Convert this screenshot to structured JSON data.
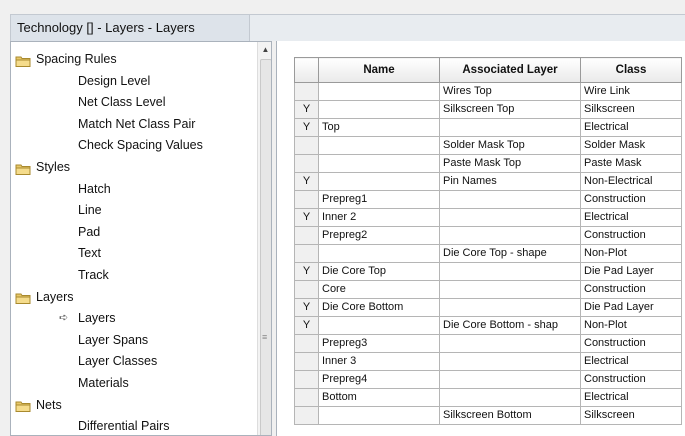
{
  "window": {
    "title": "Technology []  - Layers - Layers"
  },
  "tree": {
    "items": [
      {
        "label": "Spacing Rules",
        "type": "folder"
      },
      {
        "label": "Design Level",
        "type": "leaf"
      },
      {
        "label": "Net Class Level",
        "type": "leaf"
      },
      {
        "label": "Match Net Class Pair",
        "type": "leaf"
      },
      {
        "label": "Check Spacing Values",
        "type": "leaf"
      },
      {
        "label": "Styles",
        "type": "folder"
      },
      {
        "label": "Hatch",
        "type": "leaf"
      },
      {
        "label": "Line",
        "type": "leaf"
      },
      {
        "label": "Pad",
        "type": "leaf"
      },
      {
        "label": "Text",
        "type": "leaf"
      },
      {
        "label": "Track",
        "type": "leaf"
      },
      {
        "label": "Layers",
        "type": "folder"
      },
      {
        "label": "Layers",
        "type": "leaf",
        "selected": true
      },
      {
        "label": "Layer Spans",
        "type": "leaf"
      },
      {
        "label": "Layer Classes",
        "type": "leaf"
      },
      {
        "label": "Materials",
        "type": "leaf"
      },
      {
        "label": "Nets",
        "type": "folder"
      },
      {
        "label": "Differential Pairs",
        "type": "leaf"
      }
    ]
  },
  "grid": {
    "columns": [
      "",
      "Name",
      "Associated Layer",
      "Class"
    ],
    "rows": [
      {
        "flag": "",
        "name": "",
        "assoc": "Wires Top",
        "cls": "Wire Link"
      },
      {
        "flag": "Y",
        "name": "",
        "assoc": "Silkscreen Top",
        "cls": "Silkscreen"
      },
      {
        "flag": "Y",
        "name": "Top",
        "assoc": "",
        "cls": "Electrical"
      },
      {
        "flag": "",
        "name": "",
        "assoc": "Solder Mask Top",
        "cls": "Solder Mask"
      },
      {
        "flag": "",
        "name": "",
        "assoc": "Paste Mask Top",
        "cls": "Paste Mask"
      },
      {
        "flag": "Y",
        "name": "",
        "assoc": "Pin Names",
        "cls": "Non-Electrical"
      },
      {
        "flag": "",
        "name": "Prepreg1",
        "assoc": "",
        "cls": "Construction"
      },
      {
        "flag": "Y",
        "name": "Inner 2",
        "assoc": "",
        "cls": "Electrical"
      },
      {
        "flag": "",
        "name": "Prepreg2",
        "assoc": "",
        "cls": "Construction"
      },
      {
        "flag": "",
        "name": "",
        "assoc": "Die Core Top - shape",
        "cls": "Non-Plot"
      },
      {
        "flag": "Y",
        "name": "Die Core Top",
        "assoc": "",
        "cls": "Die Pad Layer"
      },
      {
        "flag": "",
        "name": "Core",
        "assoc": "",
        "cls": "Construction"
      },
      {
        "flag": "Y",
        "name": "Die Core Bottom",
        "assoc": "",
        "cls": "Die Pad Layer"
      },
      {
        "flag": "Y",
        "name": "",
        "assoc": "Die Core Bottom - shap",
        "cls": "Non-Plot"
      },
      {
        "flag": "",
        "name": "Prepreg3",
        "assoc": "",
        "cls": "Construction"
      },
      {
        "flag": "",
        "name": "Inner 3",
        "assoc": "",
        "cls": "Electrical"
      },
      {
        "flag": "",
        "name": "Prepreg4",
        "assoc": "",
        "cls": "Construction"
      },
      {
        "flag": "",
        "name": "Bottom",
        "assoc": "",
        "cls": "Electrical"
      },
      {
        "flag": "",
        "name": "",
        "assoc": "Silkscreen Bottom",
        "cls": "Silkscreen"
      }
    ]
  }
}
